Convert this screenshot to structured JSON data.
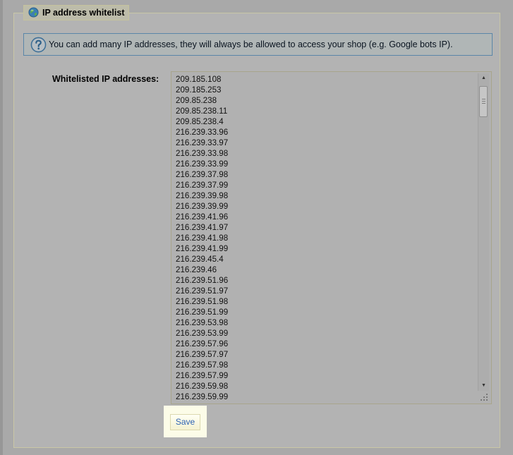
{
  "section": {
    "legend_title": "IP address whitelist",
    "legend_icon": "globe-icon"
  },
  "hint": {
    "icon": "question-circle-icon",
    "text": "You can add many IP addresses, they will always be allowed to access your shop (e.g. Google bots IP)."
  },
  "whitelist": {
    "label": "Whitelisted IP addresses:",
    "ip_addresses": [
      "209.185.108",
      "209.185.253",
      "209.85.238",
      "209.85.238.11",
      "209.85.238.4",
      "216.239.33.96",
      "216.239.33.97",
      "216.239.33.98",
      "216.239.33.99",
      "216.239.37.98",
      "216.239.37.99",
      "216.239.39.98",
      "216.239.39.99",
      "216.239.41.96",
      "216.239.41.97",
      "216.239.41.98",
      "216.239.41.99",
      "216.239.45.4",
      "216.239.46",
      "216.239.51.96",
      "216.239.51.97",
      "216.239.51.98",
      "216.239.51.99",
      "216.239.53.98",
      "216.239.53.99",
      "216.239.57.96",
      "216.239.57.97",
      "216.239.57.98",
      "216.239.57.99",
      "216.239.59.98",
      "216.239.59.99"
    ]
  },
  "actions": {
    "save_label": "Save"
  },
  "colors": {
    "hint_border": "#5a86a8",
    "save_text": "#2f63b3",
    "save_highlight": "#fcfce8"
  }
}
